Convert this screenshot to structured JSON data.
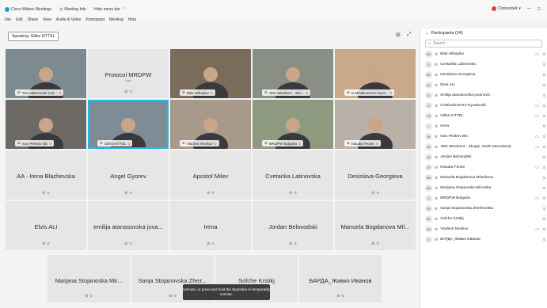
{
  "titlebar": {
    "app": "Cisco Webex Meetings",
    "meeting_info": "Meeting Info",
    "hide_menu": "Hide menu bar",
    "connection": "Connected"
  },
  "menu": [
    "File",
    "Edit",
    "Share",
    "View",
    "Audio & Video",
    "Participant",
    "Meeting",
    "Help"
  ],
  "speaking": "Speaking: Gilles KITTEL",
  "video_tiles": [
    {
      "label": "Toni Jakimovski (Vid...",
      "type": "video"
    },
    {
      "label": "Protocol MRDPW",
      "sub": "Host",
      "type": "name"
    },
    {
      "label": "Blair Mihaylov",
      "type": "video"
    },
    {
      "label": "JMC Members - Sko...",
      "type": "video"
    },
    {
      "label": "G.Mihailova-RA-Kyus...",
      "type": "video"
    },
    {
      "label": "Ivan Penkov BG",
      "type": "video"
    },
    {
      "label": "Gilles KITTEL",
      "type": "video",
      "selected": true
    },
    {
      "label": "Vladimir Moskov",
      "type": "video"
    },
    {
      "label": "MRDPW Bulgaria",
      "type": "video"
    },
    {
      "label": "Klaudia Feurle",
      "type": "video"
    }
  ],
  "name_rows": [
    [
      "AA - Irena Blazhevska",
      "Angel Gyorev",
      "Apostol Milev",
      "Cvetanka Latinovska",
      "Desislava Georgieva"
    ],
    [
      "Elvis ALI",
      "emilija atanasovska jova...",
      "Irena",
      "Jordan Belovodski",
      "Manuela Bogdanova Mil..."
    ]
  ],
  "bottom_row": [
    "Marjana Stojanoska Mir...",
    "Sanja Stojanovska Zhez...",
    "Sofche Krstikj",
    "БАРДА_Живко Иванов"
  ],
  "tooltip": "Unmute, or press and hold the Spacebar to temporarily unmute.",
  "panel": {
    "title": "Participants (24)",
    "search_placeholder": "Search",
    "participants": [
      {
        "initials": "BM",
        "name": "Blair Mihaylov",
        "camera": true
      },
      {
        "initials": "CL",
        "name": "Cvetanka Latinovska",
        "camera": false
      },
      {
        "initials": "DG",
        "name": "Desislava Georgieva",
        "camera": false
      },
      {
        "initials": "EA",
        "name": "Elvis ALI",
        "camera": false
      },
      {
        "initials": "EJ",
        "name": "emilija atanasovska jovanovic",
        "camera": false
      },
      {
        "initials": "G",
        "name": "G.Mihailova-RA-Kyustendil",
        "camera": true
      },
      {
        "initials": "GK",
        "name": "Gilles KITTEL",
        "camera": true
      },
      {
        "initials": "I",
        "name": "Irena",
        "camera": false
      },
      {
        "initials": "IB",
        "name": "Ivan Penkov BG",
        "camera": true
      },
      {
        "initials": "JM",
        "name": "JMC Members - Skopje, North Macedonia",
        "camera": true
      },
      {
        "initials": "JB",
        "name": "Jordan Belovodski",
        "camera": false
      },
      {
        "initials": "KF",
        "name": "Klaudia Feurle",
        "camera": true
      },
      {
        "initials": "MM",
        "name": "Manuela Bogdanova Milosheva",
        "camera": false
      },
      {
        "initials": "MM",
        "name": "Marijana Stojanoska Mirceska",
        "camera": false
      },
      {
        "initials": "",
        "name": "MRDPW Bulgaria",
        "camera": true
      },
      {
        "initials": "SZ",
        "name": "Sanja Stojanovska Zhezhovska",
        "camera": false
      },
      {
        "initials": "SK",
        "name": "Sofche Krstikj",
        "camera": false
      },
      {
        "initials": "VM",
        "name": "Vladimir Moskov",
        "camera": true
      },
      {
        "initials": "",
        "name": "БАРДА_Живко Иванов",
        "camera": false
      }
    ]
  },
  "colors": {
    "accent": "#23b6e8",
    "mute": "#e0443b"
  }
}
